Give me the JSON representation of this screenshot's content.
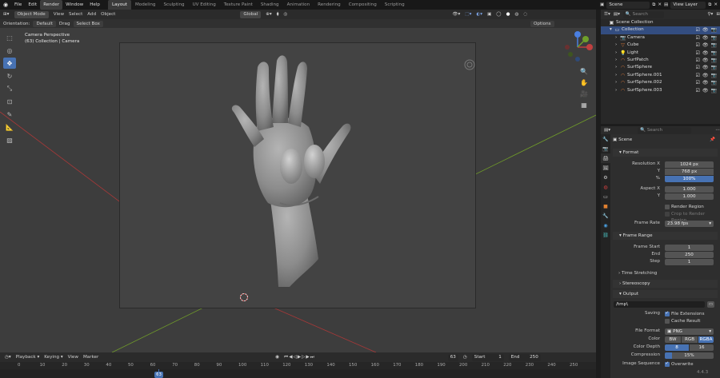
{
  "menu": [
    "File",
    "Edit",
    "Render",
    "Window",
    "Help"
  ],
  "active_menu": "Render",
  "workspaces": [
    "Layout",
    "Modeling",
    "Sculpting",
    "UV Editing",
    "Texture Paint",
    "Shading",
    "Animation",
    "Rendering",
    "Compositing",
    "Scripting"
  ],
  "active_workspace": "Layout",
  "scene_field": "Scene",
  "view_layer_field": "View Layer",
  "viewport": {
    "mode": "Object Mode",
    "header_menus": [
      "View",
      "Select",
      "Add",
      "Object"
    ],
    "orientation_label": "Orientation:",
    "orientation_value": "Default",
    "drag_label": "Drag",
    "select_box": "Select Box",
    "transform_space": "Global",
    "options": "Options",
    "overlay_line1": "Camera Perspective",
    "overlay_line2": "(63) Collection | Camera"
  },
  "timeline": {
    "menus": [
      "Playback",
      "Keying",
      "View",
      "Marker"
    ],
    "current_frame": "63",
    "start_label": "Start",
    "start": "1",
    "end_label": "End",
    "end": "250",
    "ticks": [
      "0",
      "10",
      "20",
      "30",
      "40",
      "50",
      "60",
      "70",
      "80",
      "90",
      "100",
      "110",
      "120",
      "130",
      "140",
      "150",
      "160",
      "170",
      "180",
      "190",
      "200",
      "210",
      "220",
      "230",
      "240",
      "250"
    ]
  },
  "outliner": {
    "search_placeholder": "Search",
    "rows": [
      {
        "name": "Scene Collection",
        "icon": "scene-collection-icon",
        "indent": 0
      },
      {
        "name": "Collection",
        "icon": "collection-icon",
        "indent": 1
      },
      {
        "name": "Camera",
        "icon": "camera-icon",
        "indent": 2,
        "color": "#e07b39"
      },
      {
        "name": "Cube",
        "icon": "cube-icon",
        "indent": 2,
        "color": "#e07b39"
      },
      {
        "name": "Light",
        "icon": "light-icon",
        "indent": 2,
        "color": "#e07b39"
      },
      {
        "name": "SurfPatch",
        "icon": "surface-icon",
        "indent": 2,
        "color": "#e07b39"
      },
      {
        "name": "SurfSphere",
        "icon": "surface-icon",
        "indent": 2,
        "color": "#e07b39"
      },
      {
        "name": "SurfSphere.001",
        "icon": "surface-icon",
        "indent": 2,
        "color": "#e07b39"
      },
      {
        "name": "SurfSphere.002",
        "icon": "surface-icon",
        "indent": 2,
        "color": "#e07b39"
      },
      {
        "name": "SurfSphere.003",
        "icon": "surface-icon",
        "indent": 2,
        "color": "#e07b39"
      }
    ]
  },
  "properties": {
    "search_placeholder": "Search",
    "scene_name": "Scene",
    "format": {
      "title": "Format",
      "resolution_x_label": "Resolution X",
      "resolution_x": "1024 px",
      "y_label": "Y",
      "resolution_y": "768 px",
      "pct_label": "%",
      "pct": "100%",
      "aspect_x_label": "Aspect X",
      "aspect_x": "1.000",
      "aspect_y_label": "Y",
      "aspect_y": "1.000",
      "render_region": "Render Region",
      "crop_region": "Crop to Render Region",
      "frame_rate_label": "Frame Rate",
      "frame_rate": "23.98 fps"
    },
    "frame_range": {
      "title": "Frame Range",
      "start_label": "Frame Start",
      "start": "1",
      "end_label": "End",
      "end": "250",
      "step_label": "Step",
      "step": "1",
      "time_stretching": "Time Stretching"
    },
    "stereoscopy": "Stereoscopy",
    "output": {
      "title": "Output",
      "path": "/tmp\\",
      "saving_label": "Saving",
      "file_extensions": "File Extensions",
      "cache_result": "Cache Result",
      "file_format_label": "File Format",
      "file_format": "PNG",
      "color_label": "Color",
      "color_options": [
        "BW",
        "RGB",
        "RGBA"
      ],
      "color_selected": "RGBA",
      "color_depth_label": "Color Depth",
      "depth_8": "8",
      "depth_16": "16",
      "compression_label": "Compression",
      "compression": "15%",
      "compression_fraction": 0.15,
      "image_sequence_label": "Image Sequence",
      "overwrite": "Overwrite"
    }
  },
  "version": "4.4.3",
  "colors": {
    "accent": "#4772b3",
    "x_axis": "#b03a3a",
    "y_axis": "#6f9a2a"
  }
}
